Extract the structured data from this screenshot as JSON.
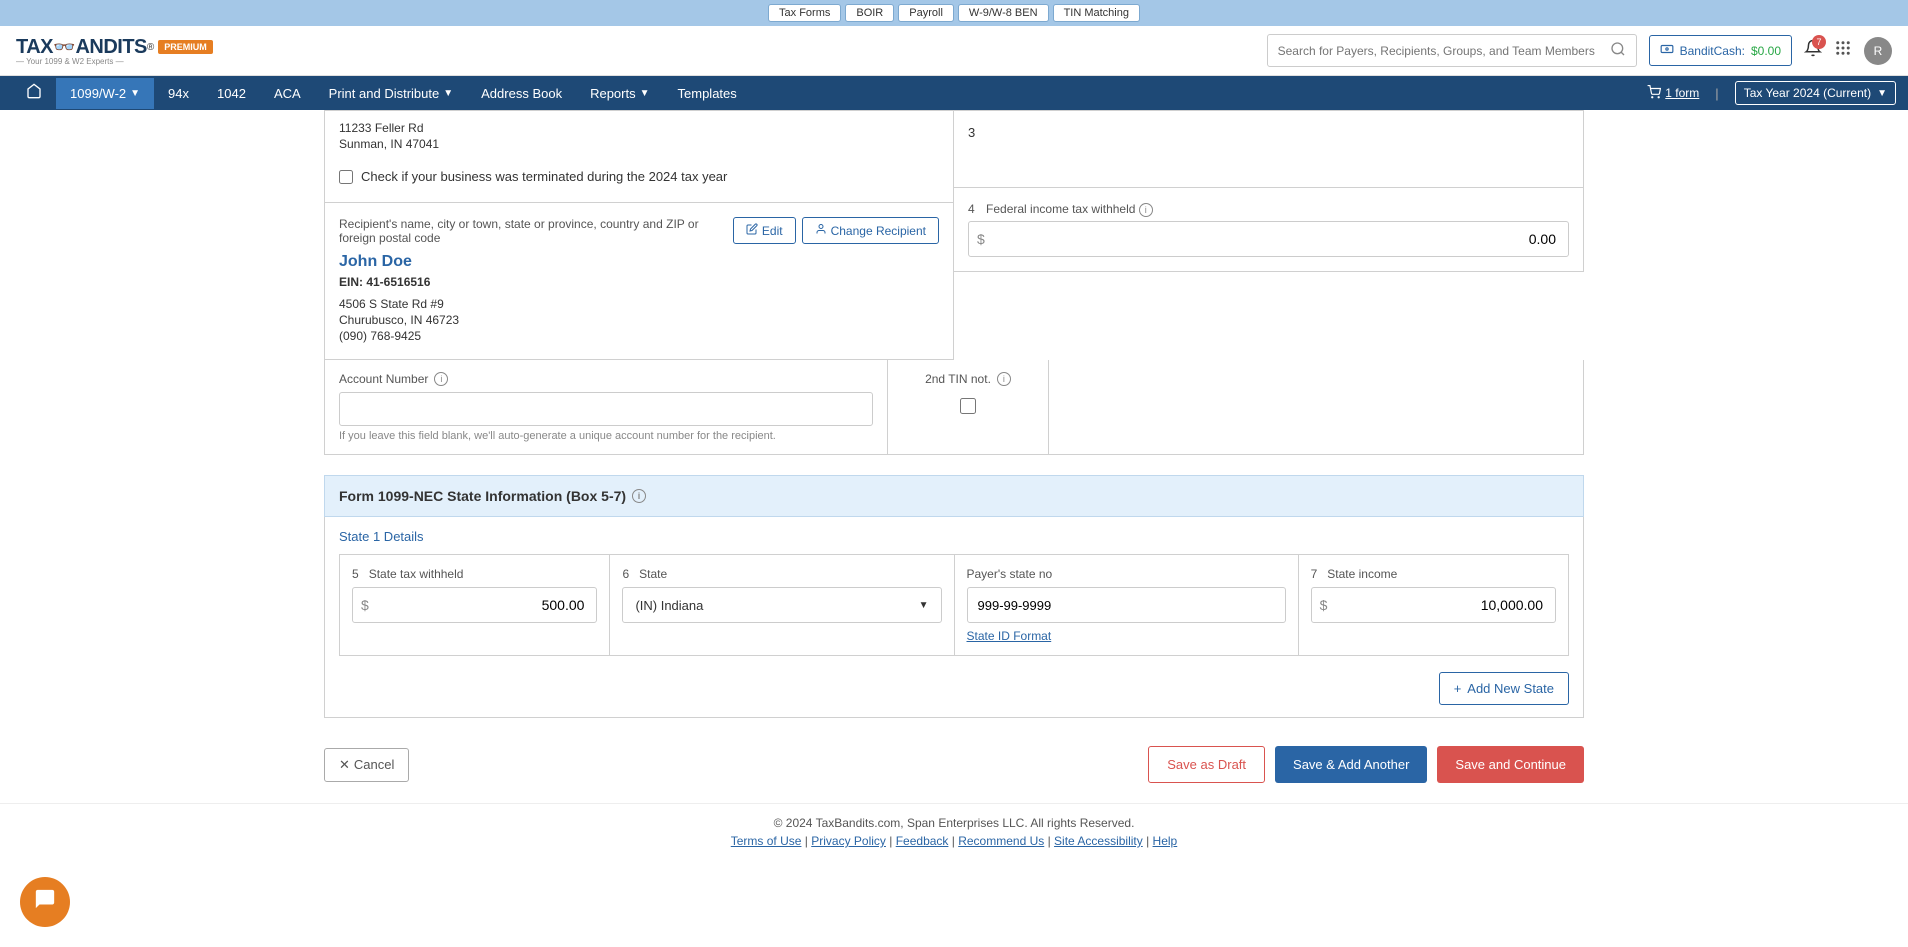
{
  "top_tabs": [
    "Tax Forms",
    "BOIR",
    "Payroll",
    "W-9/W-8 BEN",
    "TIN Matching"
  ],
  "active_top_tab": 0,
  "logo_tagline": "— Your 1099 & W2 Experts —",
  "premium_label": "PREMIUM",
  "search_placeholder": "Search for Payers, Recipients, Groups, and Team Members",
  "bandit_cash": {
    "label": "BanditCash:",
    "amount": "$0.00"
  },
  "notification_count": "7",
  "avatar_letter": "R",
  "nav_items": [
    "1099/W-2",
    "94x",
    "1042",
    "ACA",
    "Print and Distribute",
    "Address Book",
    "Reports",
    "Templates"
  ],
  "cart": {
    "label": "1 form"
  },
  "tax_year": "Tax Year 2024 (Current)",
  "payer": {
    "address1": "11233 Feller Rd",
    "address2": "Sunman, IN 47041",
    "terminated_label": "Check if your business was terminated during the 2024 tax year"
  },
  "box3": {
    "num": "3"
  },
  "recipient": {
    "section_label": "Recipient's name, city or town, state or province, country and ZIP or foreign postal code",
    "name": "John Doe",
    "ein_label": "EIN: 41-6516516",
    "address1": "4506 S State Rd #9",
    "address2": "Churubusco, IN 46723",
    "phone": "(090) 768-9425",
    "edit_label": "Edit",
    "change_label": "Change Recipient"
  },
  "box4": {
    "num": "4",
    "label": "Federal income tax withheld",
    "value": "0.00"
  },
  "account": {
    "label": "Account Number",
    "help": "If you leave this field blank, we'll auto-generate a unique account number for the recipient.",
    "tin_label": "2nd TIN not."
  },
  "state_section": {
    "title": "Form 1099-NEC  State Information  (Box 5-7)",
    "subtitle": "State 1 Details",
    "box5": {
      "num": "5",
      "label": "State tax withheld",
      "value": "500.00"
    },
    "box6": {
      "num": "6",
      "label": "State",
      "value": "(IN) Indiana"
    },
    "payer_state": {
      "label": "Payer's state no",
      "value": "999-99-9999",
      "format_link": "State ID Format"
    },
    "box7": {
      "num": "7",
      "label": "State income",
      "value": "10,000.00"
    },
    "add_state": "Add New State"
  },
  "actions": {
    "cancel": "Cancel",
    "draft": "Save as Draft",
    "save_add": "Save & Add Another",
    "save_continue": "Save and Continue"
  },
  "footer": {
    "copyright": "© 2024 TaxBandits.com, Span Enterprises LLC. All rights Reserved.",
    "links": [
      "Terms of Use",
      "Privacy Policy",
      "Feedback",
      "Recommend Us",
      "Site Accessibility",
      "Help"
    ]
  }
}
